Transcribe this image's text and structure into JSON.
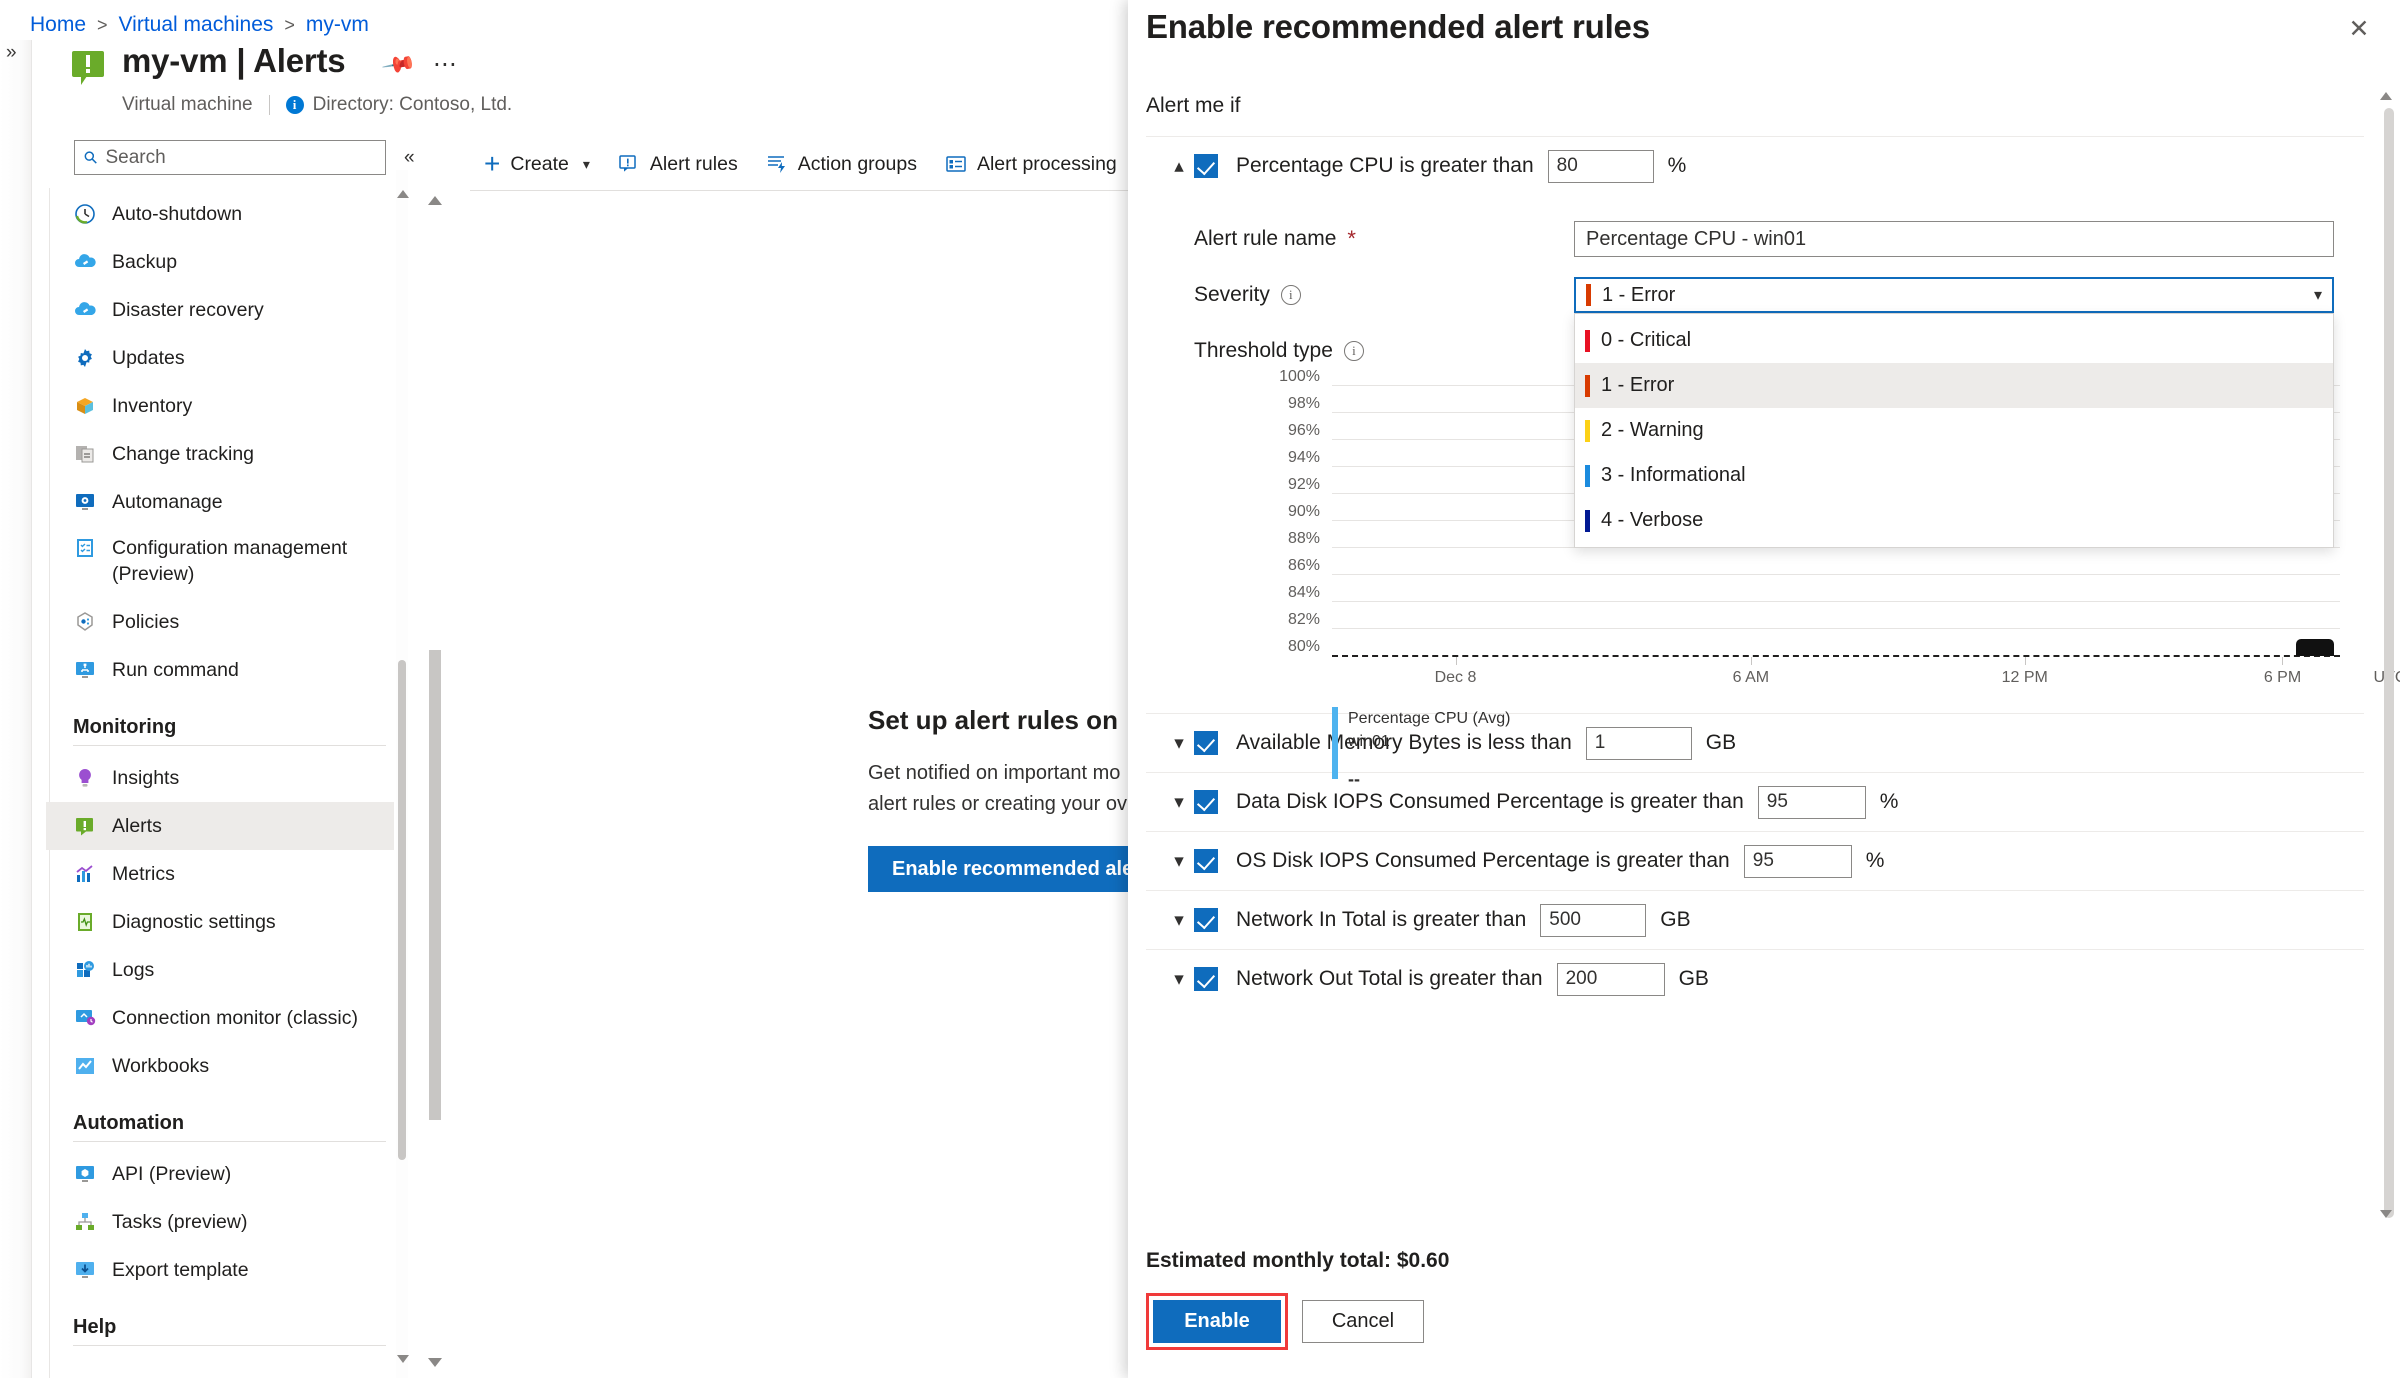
{
  "breadcrumb": {
    "items": [
      "Home",
      "Virtual machines",
      "my-vm"
    ],
    "separator": ">"
  },
  "header": {
    "title": "my-vm | Alerts",
    "resource_type": "Virtual machine",
    "directory": "Directory: Contoso, Ltd.",
    "pin_icon": "pin-icon",
    "more_icon": "ellipsis-icon",
    "alert_icon": "alert-bubble-icon"
  },
  "search": {
    "placeholder": "Search",
    "value": "",
    "icon": "search-icon",
    "collapse_icon": "double-chevron-left-icon"
  },
  "sidebar": {
    "items": [
      {
        "label": "Auto-shutdown",
        "icon": "clock-icon",
        "selected": false
      },
      {
        "label": "Backup",
        "icon": "cloud-backup-icon",
        "selected": false
      },
      {
        "label": "Disaster recovery",
        "icon": "cloud-recovery-icon",
        "selected": false
      },
      {
        "label": "Updates",
        "icon": "gear-icon",
        "selected": false
      },
      {
        "label": "Inventory",
        "icon": "box-icon",
        "selected": false
      },
      {
        "label": "Change tracking",
        "icon": "change-tracking-icon",
        "selected": false
      },
      {
        "label": "Automanage",
        "icon": "monitor-gear-icon",
        "selected": false
      },
      {
        "label": "Configuration management (Preview)",
        "icon": "checklist-icon",
        "selected": false
      },
      {
        "label": "Policies",
        "icon": "policy-icon",
        "selected": false
      },
      {
        "label": "Run command",
        "icon": "monitor-command-icon",
        "selected": false
      }
    ],
    "sections": [
      {
        "title": "Monitoring",
        "items": [
          {
            "label": "Insights",
            "icon": "lightbulb-icon",
            "selected": false
          },
          {
            "label": "Alerts",
            "icon": "alert-bubble-icon",
            "selected": true
          },
          {
            "label": "Metrics",
            "icon": "bar-chart-icon",
            "selected": false
          },
          {
            "label": "Diagnostic settings",
            "icon": "diagnostics-icon",
            "selected": false
          },
          {
            "label": "Logs",
            "icon": "logs-icon",
            "selected": false
          },
          {
            "label": "Connection monitor (classic)",
            "icon": "connection-monitor-icon",
            "selected": false
          },
          {
            "label": "Workbooks",
            "icon": "workbooks-icon",
            "selected": false
          }
        ]
      },
      {
        "title": "Automation",
        "items": [
          {
            "label": "API (Preview)",
            "icon": "api-icon",
            "selected": false
          },
          {
            "label": "Tasks (preview)",
            "icon": "tasks-icon",
            "selected": false
          },
          {
            "label": "Export template",
            "icon": "export-template-icon",
            "selected": false
          }
        ]
      },
      {
        "title": "Help",
        "items": []
      }
    ]
  },
  "command_bar": {
    "items": [
      {
        "label": "Create",
        "icon": "plus-icon",
        "has_chevron": true
      },
      {
        "label": "Alert rules",
        "icon": "alert-rules-icon",
        "has_chevron": false
      },
      {
        "label": "Action groups",
        "icon": "action-groups-icon",
        "has_chevron": false
      },
      {
        "label": "Alert processing",
        "icon": "alert-processing-icon",
        "has_chevron": false
      }
    ]
  },
  "empty_state": {
    "title": "Set up alert rules on",
    "line1": "Get notified on important mo",
    "line2": "alert rules or creating your ov",
    "button": "Enable recommended ale"
  },
  "blade": {
    "title": "Enable recommended alert rules",
    "close_icon": "close-icon",
    "section_label": "Alert me if",
    "estimated_total": "Estimated monthly total: $0.60",
    "enable_button": "Enable",
    "cancel_button": "Cancel",
    "expanded_rule": {
      "label": "Percentage CPU is greater than",
      "threshold": "80",
      "unit": "%",
      "checked": true,
      "expanded": true,
      "fields": {
        "rule_name_label": "Alert rule name",
        "rule_name_required": "*",
        "rule_name_value": "Percentage CPU - win01",
        "severity_label": "Severity",
        "severity_value": "1 - Error",
        "severity_color": "#d83b01",
        "threshold_type_label": "Threshold type",
        "info_icon": "info-icon",
        "caret_icon": "chevron-down-icon"
      },
      "severity_options": [
        {
          "label": "0 - Critical",
          "color": "#e81123",
          "hovered": false
        },
        {
          "label": "1 - Error",
          "color": "#d83b01",
          "hovered": true
        },
        {
          "label": "2 - Warning",
          "color": "#fcd116",
          "hovered": false
        },
        {
          "label": "3 - Informational",
          "color": "#1b8bde",
          "hovered": false
        },
        {
          "label": "4 - Verbose",
          "color": "#011993",
          "hovered": false
        }
      ]
    },
    "other_rules": [
      {
        "label": "Available Memory Bytes is less than",
        "value": "1",
        "unit": "GB",
        "checked": true,
        "input_width": 106
      },
      {
        "label": "Data Disk IOPS Consumed Percentage is greater than",
        "value": "95",
        "unit": "%",
        "checked": true,
        "input_width": 108
      },
      {
        "label": "OS Disk IOPS Consumed Percentage is greater than",
        "value": "95",
        "unit": "%",
        "checked": true,
        "input_width": 108
      },
      {
        "label": "Network In Total is greater than",
        "value": "500",
        "unit": "GB",
        "checked": true,
        "input_width": 106
      },
      {
        "label": "Network Out Total is greater than",
        "value": "200",
        "unit": "GB",
        "checked": true,
        "input_width": 108
      }
    ]
  },
  "chart_data": {
    "type": "line",
    "title": "",
    "xlabel": "",
    "ylabel": "",
    "ylim": [
      80,
      100
    ],
    "grid": true,
    "y_ticks": [
      "100%",
      "98%",
      "96%",
      "94%",
      "92%",
      "90%",
      "88%",
      "86%",
      "84%",
      "82%",
      "80%"
    ],
    "y_tick_values": [
      100,
      98,
      96,
      94,
      92,
      90,
      88,
      86,
      84,
      82,
      80
    ],
    "x_ticks": [
      "Dec 8",
      "6 AM",
      "12 PM",
      "6 PM",
      "UTC"
    ],
    "threshold_value": 80,
    "threshold_style": "dashed",
    "series": [
      {
        "name": "Percentage CPU (Avg)",
        "resource": "win01",
        "value": "--",
        "color": "#4eb3ef",
        "values": [
          80,
          80,
          80,
          80,
          80,
          80,
          80,
          80,
          81
        ]
      }
    ],
    "legend": {
      "position": "bottom-left",
      "title": "Percentage CPU (Avg)",
      "subtitle": "win01",
      "value": "--"
    }
  }
}
